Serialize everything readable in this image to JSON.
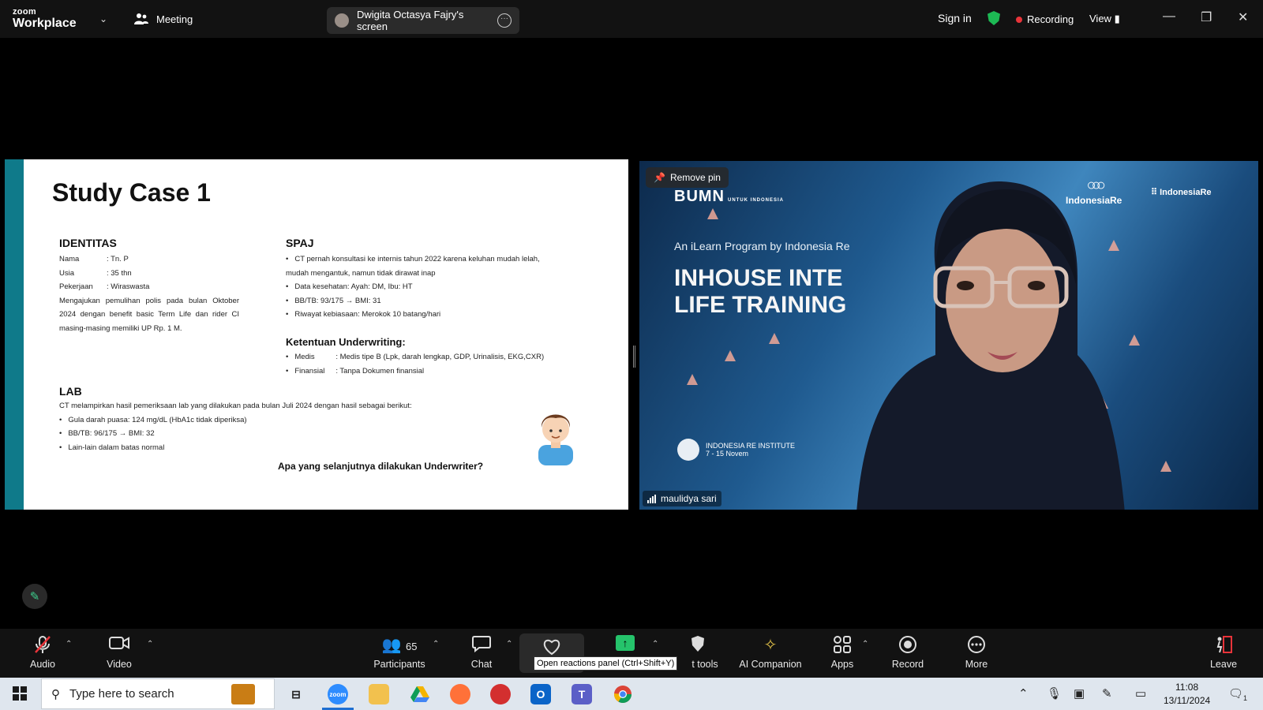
{
  "titlebar": {
    "logo_line1": "zoom",
    "logo_line2": "Workplace",
    "meeting_label": "Meeting",
    "screen_share_label": "Dwigita Octasya Fajry's screen",
    "sign_in": "Sign in",
    "recording": "Recording",
    "view": "View"
  },
  "slide": {
    "title": "Study Case 1",
    "identitas": {
      "heading": "IDENTITAS",
      "fields": [
        {
          "key": "Nama",
          "value": ": Tn. P"
        },
        {
          "key": "Usia",
          "value": ": 35 thn"
        },
        {
          "key": "Pekerjaan",
          "value": ": Wiraswasta"
        }
      ],
      "paragraph": "Mengajukan pemulihan polis pada bulan Oktober 2024 dengan benefit basic Term Life dan rider CI masing-masing memiliki UP Rp. 1 M."
    },
    "spaj": {
      "heading": "SPAJ",
      "items": [
        "CT pernah konsultasi ke internis tahun 2022 karena keluhan mudah lelah, mudah mengantuk, namun tidak dirawat inap",
        "Data kesehatan: Ayah: DM, Ibu: HT",
        "BB/TB: 93/175 → BMI: 31",
        "Riwayat kebiasaan: Merokok 10 batang/hari"
      ]
    },
    "underwriting": {
      "heading": "Ketentuan Underwriting:",
      "items": [
        {
          "key": "Medis",
          "value": ": Medis tipe B (Lpk, darah lengkap, GDP, Urinalisis, EKG,CXR)"
        },
        {
          "key": "Finansial",
          "value": ": Tanpa Dokumen finansial"
        }
      ]
    },
    "lab": {
      "heading": "LAB",
      "intro": "CT melampirkan hasil pemeriksaan lab yang dilakukan pada bulan Juli 2024 dengan hasil sebagai berikut:",
      "items": [
        "Gula darah puasa: 124 mg/dL (HbA1c tidak diperiksa)",
        "BB/TB: 96/175 → BMI: 32",
        "Lain-lain dalam batas normal"
      ]
    },
    "question": "Apa yang selanjutnya dilakukan Underwriter?"
  },
  "video": {
    "remove_pin": "Remove pin",
    "bumn_text": "BUMN",
    "bumn_sub": "UNTUK INDONESIA",
    "ir_logo": "IndonesiaRe",
    "iri_logo": "IndonesiaRe",
    "program": "An iLearn Program by Indonesia Re",
    "headline_1": "INHOUSE INTE",
    "headline_2": "LIFE TRAINING",
    "institute": "INDONESIA RE INSTITUTE",
    "institute_date": "7 - 15 Novem",
    "participant_name": "maulidya sari"
  },
  "controls": {
    "audio": "Audio",
    "video": "Video",
    "participants": "Participants",
    "participants_count": "65",
    "chat": "Chat",
    "tooltip": "Open reactions panel (Ctrl+Shift+Y)",
    "host_tools": "t tools",
    "ai_companion": "AI Companion",
    "apps": "Apps",
    "record": "Record",
    "more": "More",
    "leave": "Leave"
  },
  "taskbar": {
    "search_placeholder": "Type here to search",
    "time": "11:08",
    "date": "13/11/2024",
    "zoom_label": "zoom",
    "notifications": "1"
  },
  "colors": {
    "accent_green": "#25c36b",
    "recording_red": "#e8343a",
    "slide_bar": "#0f7a8a"
  }
}
